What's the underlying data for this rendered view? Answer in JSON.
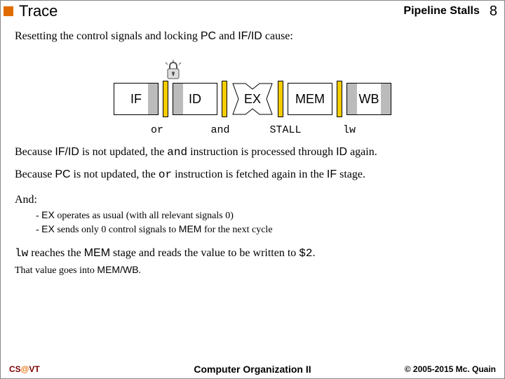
{
  "header": {
    "title": "Trace",
    "subtitle": "Pipeline Stalls",
    "slide_number": "8"
  },
  "intro": {
    "pre": "Resetting the control signals and locking ",
    "pc": "PC",
    "mid": " and ",
    "ifid": "IF/ID",
    "post": " cause:"
  },
  "stages": {
    "if": "IF",
    "id": "ID",
    "ex": "EX",
    "mem": "MEM",
    "wb": "WB"
  },
  "labels": {
    "or": "or",
    "and": "and",
    "stall": "STALL",
    "lw": "lw"
  },
  "p1": {
    "a": "Because ",
    "ifid": "IF/ID",
    "b": " is not updated, the ",
    "and": "and",
    "c": " instruction is processed through ",
    "id": "ID",
    "d": " again."
  },
  "p2": {
    "a": "Because ",
    "pc": "PC",
    "b": " is not updated, the ",
    "or": "or",
    "c": " instruction is fetched again in the ",
    "if": "IF",
    "d": " stage."
  },
  "and_heading": "And:",
  "bullets": {
    "b1a": "-  ",
    "b1_ex": "EX",
    "b1b": " operates as usual (with all relevant signals 0)",
    "b2a": "-  ",
    "b2_ex": "EX",
    "b2b": " sends only 0 control signals to ",
    "b2_mem": "MEM",
    "b2c": " for the next cycle"
  },
  "p3": {
    "lw": "lw",
    "a": " reaches the ",
    "mem": "MEM",
    "b": " stage and reads the value to be written to ",
    "reg": "$2",
    "c": "."
  },
  "p4": {
    "a": "That value goes into ",
    "memwb": "MEM/WB",
    "b": "."
  },
  "footer": {
    "left_cs": "CS",
    "left_at": "@",
    "left_vt": "VT",
    "center": "Computer Organization II",
    "right": "© 2005-2015 Mc. Quain"
  }
}
